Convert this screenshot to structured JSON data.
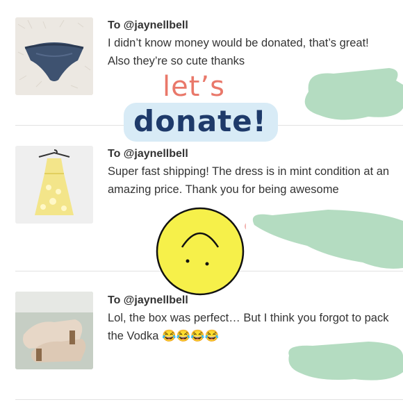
{
  "reviews": [
    {
      "to": "To @jaynellbell",
      "message": "I didn’t know money would be donated, that’s great! Also they’re so cute thanks",
      "thumbnail_icon": "lace-underwear-photo"
    },
    {
      "to": "To @jaynellbell",
      "message": "Super fast shipping! The dress is in mint condition at an amazing price. Thank you for being awesome",
      "thumbnail_icon": "yellow-dress-photo"
    },
    {
      "to": "To @jaynellbell",
      "message": "Lol, the box was perfect… But I think you forgot to pack the Vodka 😂😂😂😂",
      "thumbnail_icon": "beige-shoes-photo"
    }
  ],
  "sticker": {
    "line1": "let’s",
    "line2": "donate!",
    "line1_color": "#e9786a",
    "line2_color": "#1e3a6a",
    "highlight_color": "#d8ebf6"
  },
  "redaction_color": "#b4dcc1",
  "smiley_color": "#f6f04a"
}
